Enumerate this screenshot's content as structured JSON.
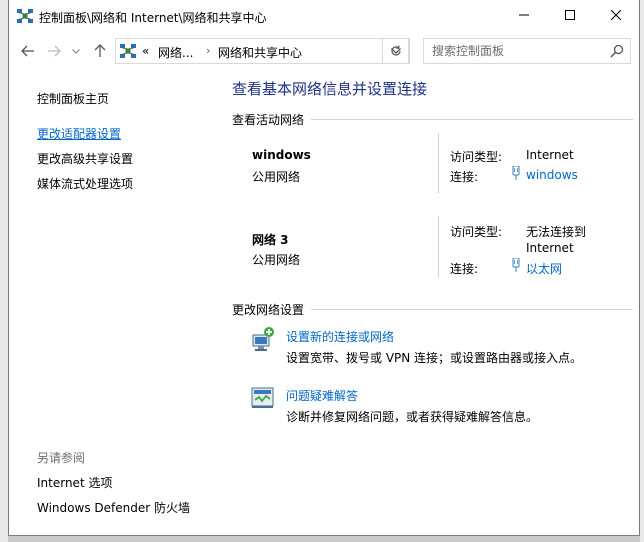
{
  "window": {
    "title": "控制面板\\网络和 Internet\\网络和共享中心"
  },
  "address": {
    "prefix": "«",
    "crumb1": "网络...",
    "crumb2": "网络和共享中心"
  },
  "search": {
    "placeholder": "搜索控制面板"
  },
  "sidebar": {
    "home": "控制面板主页",
    "items": [
      {
        "label": "更改适配器设置"
      },
      {
        "label": "更改高级共享设置"
      },
      {
        "label": "媒体流式处理选项"
      }
    ],
    "see_also": "另请参阅",
    "see_also_items": [
      {
        "label": "Internet 选项"
      },
      {
        "label": "Windows Defender 防火墙"
      }
    ]
  },
  "main": {
    "title": "查看基本网络信息并设置连接",
    "active_heading": "查看活动网络",
    "networks": [
      {
        "name": "windows",
        "type": "公用网络",
        "access_label": "访问类型:",
        "access_value": "Internet",
        "conn_label": "连接:",
        "conn_value": "windows"
      },
      {
        "name": "网络 3",
        "type": "公用网络",
        "access_label": "访问类型:",
        "access_value_line1": "无法连接到",
        "access_value_line2": "Internet",
        "conn_label": "连接:",
        "conn_value": "以太网"
      }
    ],
    "change_heading": "更改网络设置",
    "tasks": [
      {
        "label": "设置新的连接或网络",
        "desc": "设置宽带、拨号或 VPN 连接；或设置路由器或接入点。"
      },
      {
        "label": "问题疑难解答",
        "desc": "诊断并修复网络问题，或者获得疑难解答信息。"
      }
    ]
  },
  "colors": {
    "link": "#0066cc",
    "title": "#1e3287",
    "separator": "#d3d3d3"
  },
  "icons": [
    "network-center-icon",
    "back-arrow-icon",
    "forward-arrow-icon",
    "history-dropdown-icon",
    "up-arrow-icon",
    "refresh-icon",
    "search-icon",
    "minimize-icon",
    "maximize-icon",
    "close-icon",
    "adapter-icon",
    "new-connection-icon",
    "troubleshoot-icon"
  ]
}
